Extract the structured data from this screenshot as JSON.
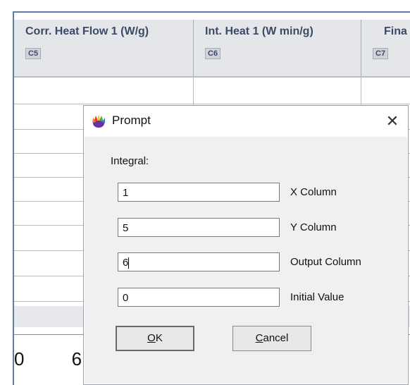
{
  "grid": {
    "columns": [
      {
        "title": "Corr. Heat Flow 1 (W/g)",
        "code": "C5"
      },
      {
        "title": "Int. Heat 1  (W min/g)",
        "code": "C6"
      },
      {
        "title": "Fina",
        "code": "C7"
      }
    ],
    "bottom_digits": "0  6"
  },
  "dialog": {
    "title": "Prompt",
    "close_glyph": "✕",
    "heading": "Integral:",
    "fields": [
      {
        "value": "1",
        "label": "X Column"
      },
      {
        "value": "5",
        "label": "Y Column"
      },
      {
        "value": "6",
        "label": "Output Column"
      },
      {
        "value": "0",
        "label": "Initial Value"
      }
    ],
    "ok_label": "OK",
    "cancel_label": "Cancel",
    "icon": "app-flower-icon"
  }
}
